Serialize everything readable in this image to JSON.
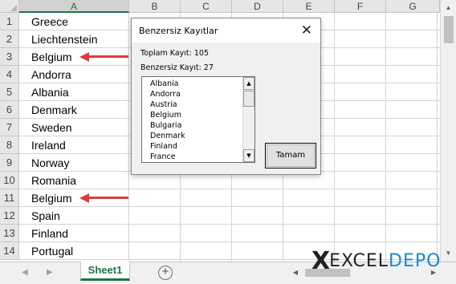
{
  "sheet": {
    "column_headers": [
      "A",
      "B",
      "C",
      "D",
      "E",
      "F",
      "G"
    ],
    "row_numbers": [
      "1",
      "2",
      "3",
      "4",
      "5",
      "6",
      "7",
      "8",
      "9",
      "10",
      "11",
      "12",
      "13",
      "14"
    ],
    "column_a_values": [
      "Greece",
      "Liechtenstein",
      "Belgium",
      "Andorra",
      "Albania",
      "Denmark",
      "Sweden",
      "Ireland",
      "Norway",
      "Romania",
      "Belgium",
      "Spain",
      "Finland",
      "Portugal"
    ],
    "arrow_color": "#e03a3a"
  },
  "dialog": {
    "title": "Benzersiz Kayıtlar",
    "close_glyph": "✕",
    "total_label": "Toplam Kayıt: 105",
    "unique_label": "Benzersiz Kayıt: 27",
    "list_items": [
      "Albania",
      "Andorra",
      "Austria",
      "Belgium",
      "Bulgaria",
      "Denmark",
      "Finland",
      "France"
    ],
    "ok_button_label": "Tamam"
  },
  "tabs": {
    "sheet_name": "Sheet1",
    "add_sheet_symbol": "+",
    "nav_left": "◀",
    "nav_right": "▶"
  },
  "logo": {
    "x_mark": "X",
    "text_excel": "EXCEL",
    "text_depo": "DEPO",
    "depo_color": "#1e8bc3"
  },
  "colors": {
    "excel_green": "#217346",
    "header_bg": "#e6e6e6"
  }
}
